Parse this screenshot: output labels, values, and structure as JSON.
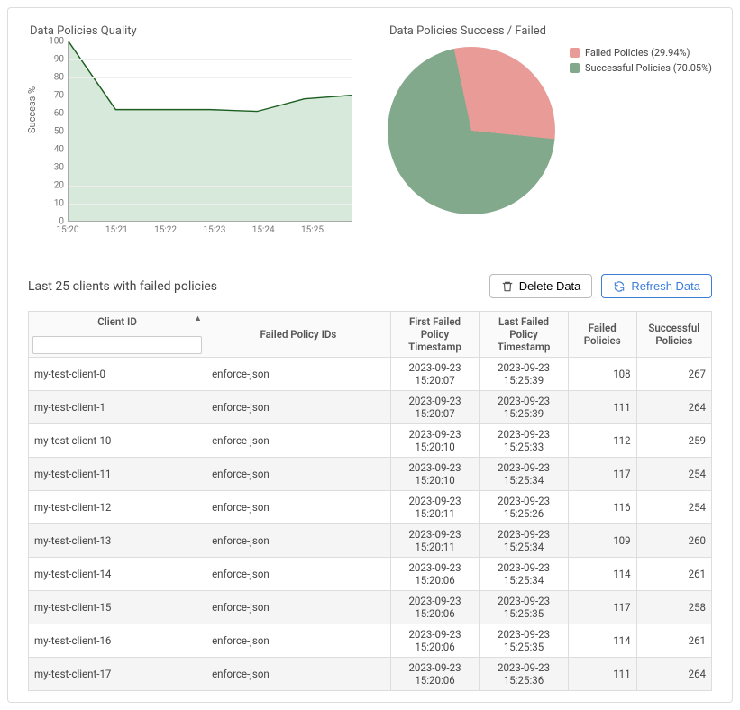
{
  "chart_data": [
    {
      "type": "area",
      "title": "Data Policies Quality",
      "ylabel": "Success %",
      "xlabel": "",
      "ylim": [
        0,
        100
      ],
      "y_ticks": [
        0,
        10,
        20,
        30,
        40,
        50,
        60,
        70,
        80,
        90,
        100
      ],
      "x_ticks": [
        "15:20",
        "15:21",
        "15:22",
        "15:23",
        "15:24",
        "15:25"
      ],
      "categories": [
        "15:20",
        "15:21",
        "15:22",
        "15:23",
        "15:24",
        "15:25",
        "15:25:30"
      ],
      "values": [
        100,
        62,
        62,
        62,
        61,
        68,
        70
      ],
      "colors": {
        "line": "#1b5e20",
        "fill": "#d7e9da"
      }
    },
    {
      "type": "pie",
      "title": "Data Policies Success / Failed",
      "series": [
        {
          "name": "Failed Policies",
          "pct": 29.94,
          "color": "#e89b97"
        },
        {
          "name": "Successful Policies",
          "pct": 70.05,
          "color": "#83a98c"
        }
      ],
      "legend_labels": [
        "Failed Policies (29.94%)",
        "Successful Policies (70.05%)"
      ]
    }
  ],
  "section": {
    "title": "Last 25 clients with failed policies"
  },
  "buttons": {
    "delete": "Delete Data",
    "refresh": "Refresh Data"
  },
  "table": {
    "columns": [
      "Client ID",
      "Failed Policy IDs",
      "First Failed Policy Timestamp",
      "Last Failed Policy Timestamp",
      "Failed Policies",
      "Successful Policies"
    ],
    "filter_value": "",
    "rows": [
      {
        "client": "my-test-client-0",
        "policy": "enforce-json",
        "first": "2023-09-23 15:20:07",
        "last": "2023-09-23 15:25:39",
        "failed": 108,
        "success": 267
      },
      {
        "client": "my-test-client-1",
        "policy": "enforce-json",
        "first": "2023-09-23 15:20:07",
        "last": "2023-09-23 15:25:39",
        "failed": 111,
        "success": 264
      },
      {
        "client": "my-test-client-10",
        "policy": "enforce-json",
        "first": "2023-09-23 15:20:10",
        "last": "2023-09-23 15:25:33",
        "failed": 112,
        "success": 259
      },
      {
        "client": "my-test-client-11",
        "policy": "enforce-json",
        "first": "2023-09-23 15:20:10",
        "last": "2023-09-23 15:25:34",
        "failed": 117,
        "success": 254
      },
      {
        "client": "my-test-client-12",
        "policy": "enforce-json",
        "first": "2023-09-23 15:20:11",
        "last": "2023-09-23 15:25:26",
        "failed": 116,
        "success": 254
      },
      {
        "client": "my-test-client-13",
        "policy": "enforce-json",
        "first": "2023-09-23 15:20:11",
        "last": "2023-09-23 15:25:34",
        "failed": 109,
        "success": 260
      },
      {
        "client": "my-test-client-14",
        "policy": "enforce-json",
        "first": "2023-09-23 15:20:06",
        "last": "2023-09-23 15:25:34",
        "failed": 114,
        "success": 261
      },
      {
        "client": "my-test-client-15",
        "policy": "enforce-json",
        "first": "2023-09-23 15:20:06",
        "last": "2023-09-23 15:25:35",
        "failed": 117,
        "success": 258
      },
      {
        "client": "my-test-client-16",
        "policy": "enforce-json",
        "first": "2023-09-23 15:20:06",
        "last": "2023-09-23 15:25:35",
        "failed": 114,
        "success": 261
      },
      {
        "client": "my-test-client-17",
        "policy": "enforce-json",
        "first": "2023-09-23 15:20:06",
        "last": "2023-09-23 15:25:36",
        "failed": 111,
        "success": 264
      }
    ]
  }
}
